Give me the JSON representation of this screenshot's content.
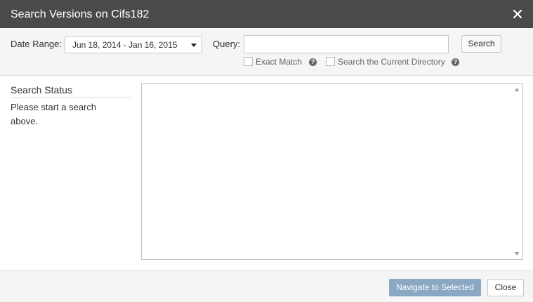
{
  "dialog": {
    "title": "Search Versions on Cifs182"
  },
  "toolbar": {
    "date_range_label": "Date Range:",
    "date_range_value": "Jun 18, 2014 - Jan 16, 2015",
    "query_label": "Query:",
    "query_value": "",
    "query_placeholder": "",
    "search_label": "Search",
    "exact_match_label": "Exact Match",
    "exact_match_checked": false,
    "current_dir_label": "Search the Current Directory",
    "current_dir_checked": false,
    "help_glyph": "?"
  },
  "status": {
    "title": "Search Status",
    "message": "Please start a search above."
  },
  "footer": {
    "navigate_label": "Navigate to Selected",
    "close_label": "Close"
  },
  "icons": {
    "close": "close-icon",
    "dropdown": "chevron-down-icon",
    "help": "help-icon",
    "scroll_up": "scroll-up-icon",
    "scroll_down": "scroll-down-icon"
  },
  "colors": {
    "titlebar": "#4a4a4a",
    "toolbar_bg": "#f5f5f5",
    "primary_disabled": "#8aa7c3"
  }
}
